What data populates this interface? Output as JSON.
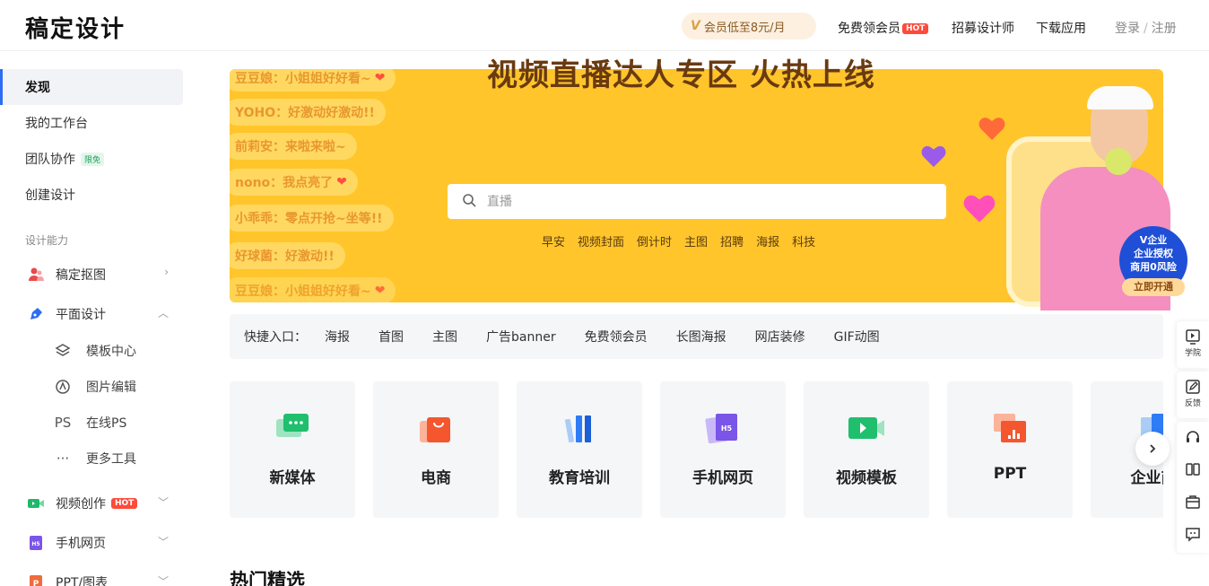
{
  "header": {
    "logo": "稿定设计",
    "vip_text": "会员低至8元/月",
    "vip_mark": "V",
    "nav": [
      {
        "label": "免费领会员",
        "badge": "HOT"
      },
      {
        "label": "招募设计师"
      },
      {
        "label": "下载应用"
      }
    ],
    "login": "登录",
    "register": "注册",
    "login_sep": "/"
  },
  "sidebar": {
    "top_items": [
      {
        "label": "发现",
        "active": true
      },
      {
        "label": "我的工作台"
      },
      {
        "label": "团队协作",
        "badge": "限免"
      },
      {
        "label": "创建设计"
      }
    ],
    "section_label": "设计能力",
    "capabilities": [
      {
        "label": "稿定抠图",
        "icon": "people-cutout-icon",
        "expand": "right"
      },
      {
        "label": "平面设计",
        "icon": "pen-icon",
        "expand": "up"
      },
      {
        "label": "视频创作",
        "icon": "video-icon",
        "expand": "down",
        "badge": "HOT"
      },
      {
        "label": "手机网页",
        "icon": "h5-icon",
        "expand": "down"
      },
      {
        "label": "PPT/图表",
        "icon": "ppt-icon",
        "expand": "down"
      }
    ],
    "sub_items": [
      {
        "label": "模板中心",
        "icon": "layers-icon"
      },
      {
        "label": "图片编辑",
        "icon": "edit-circle-icon"
      },
      {
        "label": "在线PS",
        "icon": "ps-icon",
        "glyph": "PS"
      },
      {
        "label": "更多工具",
        "icon": "more-icon",
        "glyph": "···"
      }
    ]
  },
  "banner": {
    "title": "视频直播达人专区 火热上线",
    "search_placeholder": "直播",
    "tags": [
      "早安",
      "视频封面",
      "倒计时",
      "主图",
      "招聘",
      "海报",
      "科技"
    ],
    "bubbles": [
      "豆豆娘：小姐姐好好看~",
      "YOHO：好激动好激动!!",
      "前莉安：来啦来啦~",
      "nono：我点亮了",
      "小乖乖：零点开抢~坐等!!",
      "好球菌：好激动!!",
      "豆豆娘：小姐姐好好看~"
    ],
    "enterprise": {
      "brand": "V企业",
      "line1": "企业授权",
      "line2": "商用0风险",
      "button": "立即开通"
    }
  },
  "quick_entry": {
    "label": "快捷入口：",
    "links": [
      "海报",
      "首图",
      "主图",
      "广告banner",
      "免费领会员",
      "长图海报",
      "网店装修",
      "GIF动图"
    ]
  },
  "categories": [
    {
      "label": "新媒体",
      "icon": "chat-icon"
    },
    {
      "label": "电商",
      "icon": "shopping-bag-icon"
    },
    {
      "label": "教育培训",
      "icon": "books-icon"
    },
    {
      "label": "手机网页",
      "icon": "h5-page-icon"
    },
    {
      "label": "视频模板",
      "icon": "video-template-icon"
    },
    {
      "label": "PPT",
      "icon": "ppt-chart-icon"
    },
    {
      "label": "企业商",
      "icon": "enterprise-icon"
    }
  ],
  "section_title": "热门精选",
  "toolbar": [
    {
      "label": "学院",
      "icon": "play-box-icon"
    },
    {
      "label": "反馈",
      "icon": "feedback-icon"
    },
    {
      "label": "",
      "icon": "headset-icon"
    },
    {
      "label": "",
      "icon": "book-open-icon"
    },
    {
      "label": "",
      "icon": "mailbox-icon"
    },
    {
      "label": "",
      "icon": "message-icon"
    }
  ],
  "colors": {
    "accent": "#2e6cf6",
    "banner": "#ffc52b",
    "hot": "#ff4a3a"
  }
}
